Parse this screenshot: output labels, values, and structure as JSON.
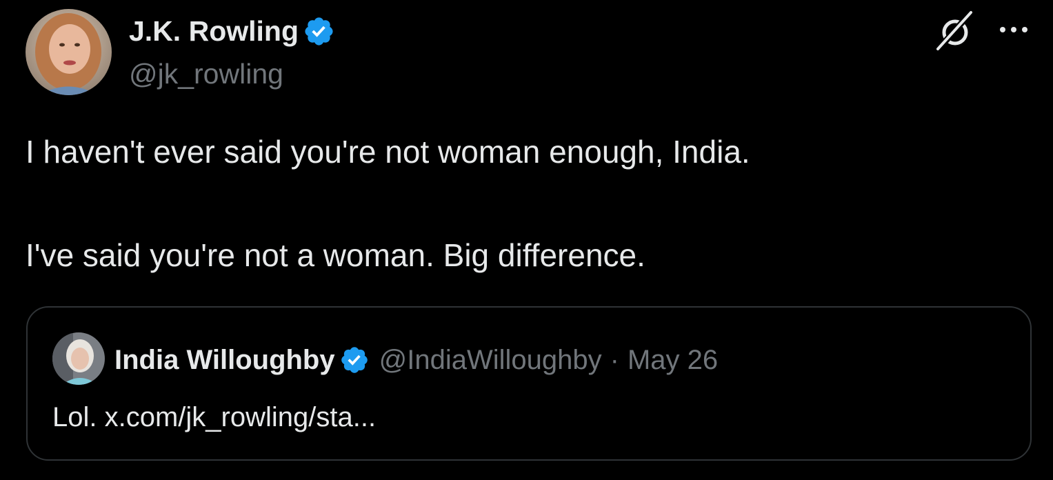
{
  "tweet": {
    "author": {
      "name": "J.K. Rowling",
      "handle": "@jk_rowling",
      "verified": true
    },
    "text_paragraphs": [
      "I haven't ever said you're not woman enough, India.",
      "I've said you're not a woman. Big difference."
    ],
    "actions": {
      "grok_icon": "grok-icon",
      "more_icon": "more-options-icon"
    }
  },
  "quoted_tweet": {
    "author": {
      "name": "India Willoughby",
      "handle": "@IndiaWilloughby",
      "verified": true
    },
    "separator": "·",
    "date": "May 26",
    "text": "Lol. x.com/jk_rowling/sta..."
  },
  "colors": {
    "background": "#000000",
    "primary_text": "#e7e9ea",
    "secondary_text": "#71767b",
    "verified_badge": "#1d9bf0",
    "card_border": "#2f3336"
  }
}
